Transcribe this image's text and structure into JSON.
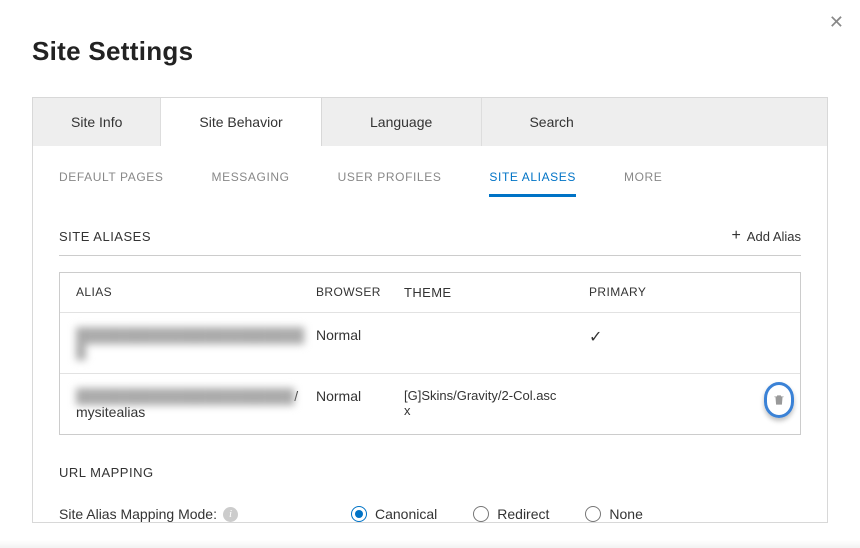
{
  "page_title": "Site Settings",
  "close_label": "✕",
  "main_tabs": {
    "site_info": "Site Info",
    "site_behavior": "Site Behavior",
    "language": "Language",
    "search": "Search",
    "active": "site_behavior"
  },
  "sub_tabs": {
    "default_pages": "DEFAULT PAGES",
    "messaging": "MESSAGING",
    "user_profiles": "USER PROFILES",
    "site_aliases": "SITE ALIASES",
    "more": "MORE",
    "active": "site_aliases"
  },
  "section": {
    "title": "SITE ALIASES",
    "add_label": "Add Alias"
  },
  "table": {
    "headers": {
      "alias": "ALIAS",
      "browser": "BROWSER",
      "theme": "THEME",
      "primary": "PRIMARY"
    },
    "rows": [
      {
        "alias_hidden": "████████████████████████",
        "alias_visible": "",
        "alias_suffix": "",
        "browser": "Normal",
        "theme": "",
        "primary": true,
        "show_delete_highlight": false
      },
      {
        "alias_hidden": "██████████████████████",
        "alias_visible": "/mysitealias",
        "browser": "Normal",
        "theme": "[G]Skins/Gravity/2-Col.ascx",
        "primary": false,
        "show_delete_highlight": true
      }
    ]
  },
  "url_mapping": {
    "title": "URL MAPPING",
    "mode_label": "Site Alias Mapping Mode:",
    "options": {
      "canonical": "Canonical",
      "redirect": "Redirect",
      "none": "None",
      "selected": "canonical"
    }
  },
  "icons": {
    "check": "✓",
    "plus": "+"
  }
}
